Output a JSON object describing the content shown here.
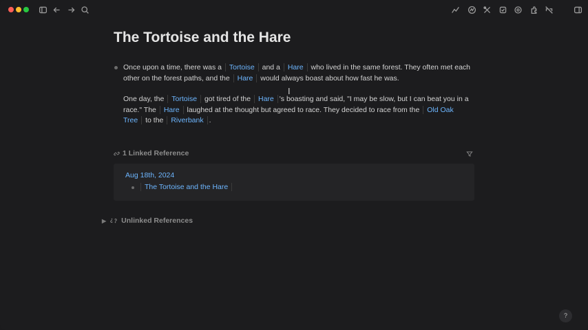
{
  "titlebar": {
    "left_icons": [
      "sidebar-toggle-icon",
      "arrow-left-icon",
      "arrow-right-icon",
      "search-icon"
    ],
    "right_icons": [
      "graph-icon",
      "publish-icon",
      "tools-icon",
      "task-icon",
      "sync-icon",
      "plugin-icon",
      "accessibility-icon",
      "right-sidebar-icon"
    ]
  },
  "page": {
    "title": "The Tortoise and the Hare"
  },
  "paragraph1": {
    "t1": "Once upon a time, there was a ",
    "r1": "Tortoise",
    "t2": " and a ",
    "r2": "Hare",
    "t3": " who lived in the same forest. They often met each other on the forest paths, and the ",
    "r3": "Hare",
    "t4": " would always boast about how fast he was."
  },
  "paragraph2": {
    "t1": "One day, the ",
    "r1": "Tortoise",
    "t2": " got tired of the ",
    "r2": "Hare",
    "t3": "'s boasting and said, \"I may be slow, but I can beat you in a race.\" The ",
    "r3": "Hare",
    "t4": " laughed at the thought but agreed to race. They decided to race from the ",
    "r4": "Old Oak Tree",
    "t5": " to the ",
    "r5": "Riverbank",
    "t6": "."
  },
  "linked_references": {
    "header": "1 Linked Reference",
    "date": "Aug 18th, 2024",
    "item": "The Tortoise and the Hare"
  },
  "unlinked_references": {
    "header": "Unlinked References"
  },
  "help": {
    "label": "?"
  },
  "colors": {
    "background": "#1c1c1e",
    "link": "#6db6ff",
    "text": "#d4d4d4"
  }
}
